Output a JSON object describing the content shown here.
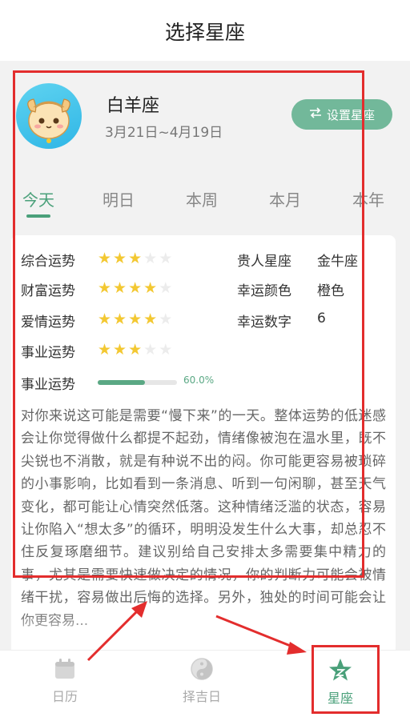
{
  "header": {
    "title": "选择星座"
  },
  "profile": {
    "sign_name": "白羊座",
    "date_range": "3月21日~4月19日",
    "set_button_label": "设置星座",
    "set_button_icon": "swap-icon"
  },
  "tabs": [
    {
      "label": "今天",
      "active": true
    },
    {
      "label": "明日",
      "active": false
    },
    {
      "label": "本周",
      "active": false
    },
    {
      "label": "本月",
      "active": false
    },
    {
      "label": "本年",
      "active": false
    }
  ],
  "fortune": {
    "ratings": [
      {
        "label": "综合运势",
        "stars": 3,
        "max": 5
      },
      {
        "label": "财富运势",
        "stars": 4,
        "max": 5
      },
      {
        "label": "爱情运势",
        "stars": 4,
        "max": 5
      },
      {
        "label": "事业运势",
        "stars": 3,
        "max": 5
      }
    ],
    "info": [
      {
        "label": "贵人星座",
        "value": "金牛座"
      },
      {
        "label": "幸运颜色",
        "value": "橙色"
      },
      {
        "label": "幸运数字",
        "value": "6"
      }
    ],
    "progress": {
      "label": "事业运势",
      "percent": 60.0,
      "percent_text": "60.0%"
    },
    "description": "对你来说这可能是需要“慢下来”的一天。整体运势的低迷感会让你觉得做什么都提不起劲，情绪像被泡在温水里，既不尖锐也不消散，就是有种说不出的闷。你可能更容易被琐碎的小事影响，比如看到一条消息、听到一句闲聊，甚至天气变化，都可能让心情突然低落。这种情绪泛滥的状态，容易让你陷入“想太多”的循环，明明没发生什么大事，却总忍不住反复琢磨细节。建议别给自己安排太多需要集中精力的事，尤其是需要快速做决定的情况，你的判断力可能会被情绪干扰，容易做出后悔的选择。另外，独处的时间可能会让你更容易..."
  },
  "bottom_nav": [
    {
      "label": "日历",
      "icon": "calendar-icon",
      "active": false
    },
    {
      "label": "择吉日",
      "icon": "yin-yang-icon",
      "active": false
    },
    {
      "label": "星座",
      "icon": "star-icon",
      "active": true
    }
  ],
  "colors": {
    "accent": "#4aa07a",
    "button": "#72b89a",
    "star": "#f3c832",
    "annotation": "#e32d2d"
  }
}
